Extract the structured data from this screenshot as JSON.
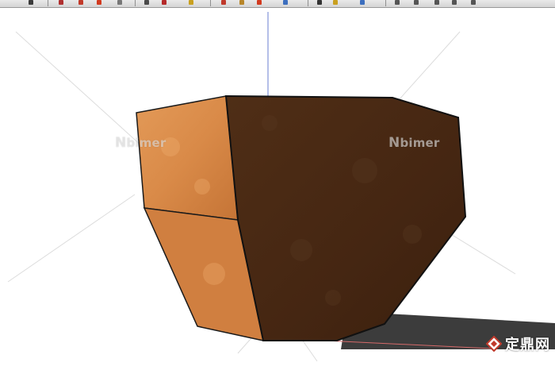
{
  "toolbar": {
    "buttons": [
      {
        "name": "select-tool-button",
        "icon": "arrow-icon",
        "color": "#3b3b3b"
      },
      {
        "name": "eraser-tool-button",
        "icon": "eraser-icon",
        "color": "#b03030"
      },
      {
        "name": "line-tool-button",
        "icon": "pencil-icon",
        "color": "#c23a2a"
      },
      {
        "name": "arc-tool-button",
        "icon": "arc-icon",
        "color": "#d23a1f"
      },
      {
        "name": "paint-bucket-button",
        "icon": "bucket-icon",
        "color": "#777777"
      },
      {
        "name": "push-pull-button",
        "icon": "push-pull-icon",
        "color": "#4a4a4a"
      },
      {
        "name": "move-tool-button",
        "icon": "move-icon",
        "color": "#b52a2a"
      },
      {
        "name": "rotate-tool-button",
        "icon": "rotate-icon",
        "color": "#c9a020"
      },
      {
        "name": "follow-me-button",
        "icon": "follow-me-icon",
        "color": "#c0392b"
      },
      {
        "name": "scale-tool-button",
        "icon": "scale-icon",
        "color": "#b8862a"
      },
      {
        "name": "offset-tool-button",
        "icon": "offset-icon",
        "color": "#d23a1f"
      },
      {
        "name": "tape-measure-button",
        "icon": "tape-icon",
        "color": "#3d6fbf"
      },
      {
        "name": "orbit-tool-button",
        "icon": "orbit-icon",
        "color": "#333333"
      },
      {
        "name": "pan-tool-button",
        "icon": "hand-icon",
        "color": "#c9a020"
      },
      {
        "name": "zoom-tool-button",
        "icon": "zoom-icon",
        "color": "#3d6fbf"
      },
      {
        "name": "iso-view-button",
        "icon": "iso-cube-icon",
        "color": "#555555"
      },
      {
        "name": "top-view-button",
        "icon": "top-view-icon",
        "color": "#555555"
      },
      {
        "name": "front-view-button",
        "icon": "front-view-icon",
        "color": "#555555"
      },
      {
        "name": "right-view-button",
        "icon": "right-view-icon",
        "color": "#555555"
      },
      {
        "name": "back-view-button",
        "icon": "back-view-icon",
        "color": "#555555"
      }
    ]
  },
  "viewport": {
    "watermark_left": "bimer",
    "watermark_right": "bimer",
    "site_badge_text": "定鼎网",
    "site_badge_icon": "diamond-logo-icon",
    "colors": {
      "planter_front": "#4a2a14",
      "planter_side": "#d98a48",
      "shadow": "#3a3a3a",
      "axis_blue": "#6a7fd1",
      "axis_red": "#d46a6a"
    }
  }
}
